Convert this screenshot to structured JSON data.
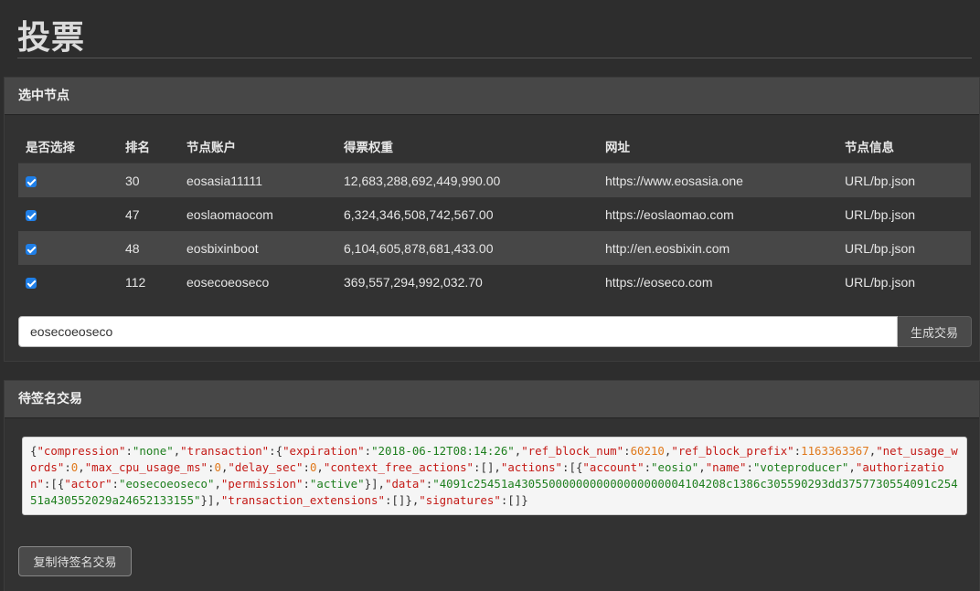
{
  "page": {
    "title": "投票"
  },
  "selected_panel": {
    "heading": "选中节点",
    "columns": [
      "是否选择",
      "排名",
      "节点账户",
      "得票权重",
      "网址",
      "节点信息"
    ],
    "rows": [
      {
        "checked": true,
        "rank": "30",
        "account": "eosasia11111",
        "weight": "12,683,288,692,449,990.00",
        "url": "https://www.eosasia.one",
        "info": "URL/bp.json"
      },
      {
        "checked": true,
        "rank": "47",
        "account": "eoslaomaocom",
        "weight": "6,324,346,508,742,567.00",
        "url": "https://eoslaomao.com",
        "info": "URL/bp.json"
      },
      {
        "checked": true,
        "rank": "48",
        "account": "eosbixinboot",
        "weight": "6,104,605,878,681,433.00",
        "url": "http://en.eosbixin.com",
        "info": "URL/bp.json"
      },
      {
        "checked": true,
        "rank": "112",
        "account": "eosecoeoseco",
        "weight": "369,557,294,992,032.70",
        "url": "https://eoseco.com",
        "info": "URL/bp.json"
      }
    ],
    "account_input_value": "eosecoeoseco",
    "generate_button": "生成交易"
  },
  "unsigned_panel": {
    "heading": "待签名交易",
    "json_text": "{\"compression\":\"none\",\"transaction\":{\"expiration\":\"2018-06-12T08:14:26\",\"ref_block_num\":60210,\"ref_block_prefix\":1163363367,\"net_usage_words\":0,\"max_cpu_usage_ms\":0,\"delay_sec\":0,\"context_free_actions\":[],\"actions\":[{\"account\":\"eosio\",\"name\":\"voteproducer\",\"authorization\":[{\"actor\":\"eosecoeoseco\",\"permission\":\"active\"}],\"data\":\"4091c25451a4305500000000000000000004104208c1386c305590293dd3757730554091c25451a430552029a24652133155\"}],\"transaction_extensions\":[]},\"signatures\":[]}",
    "copy_button": "复制待签名交易"
  },
  "colors": {
    "background": "#2d2d2d",
    "panel_heading": "#474747",
    "link_green": "#3fd68f",
    "checkbox_blue": "#1f7fe8",
    "json_key": "#c41a16",
    "json_string": "#1e7f1e",
    "json_number": "#e0791c"
  }
}
